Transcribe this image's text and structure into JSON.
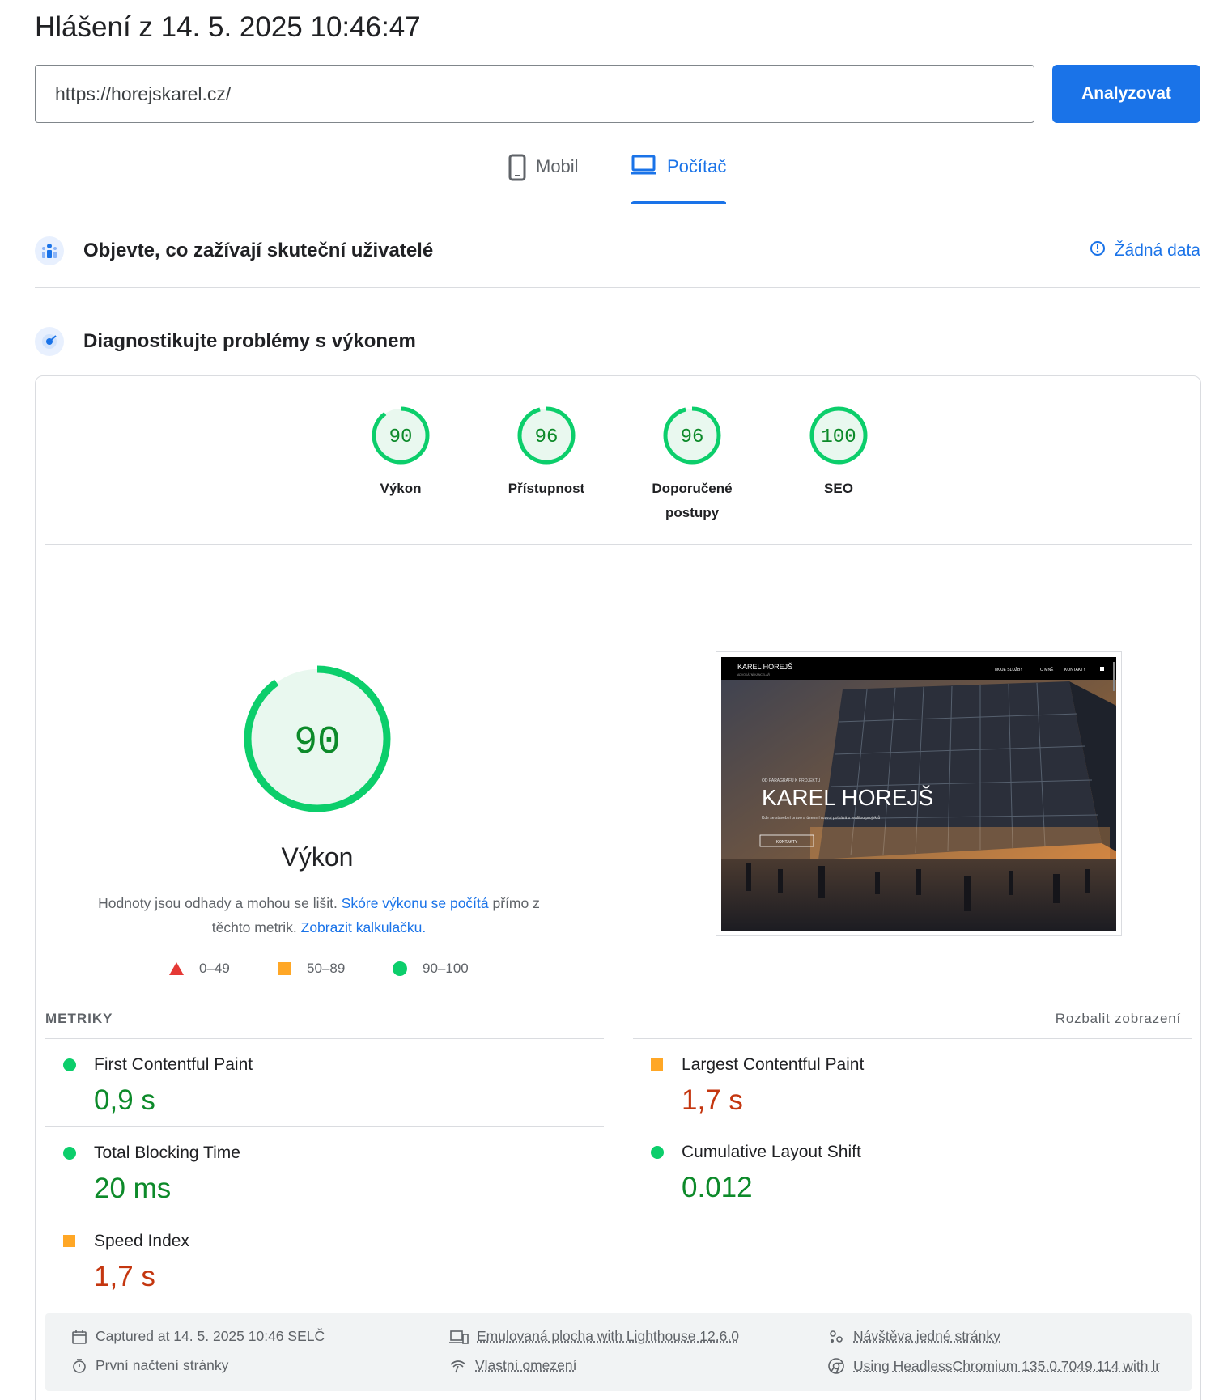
{
  "header": {
    "title": "Hlášení z 14. 5. 2025 10:46:47"
  },
  "search": {
    "url_value": "https://horejskarel.cz/",
    "analyze_label": "Analyzovat"
  },
  "tabs": [
    {
      "label": "Mobil",
      "icon": "phone-icon",
      "active": false
    },
    {
      "label": "Počítač",
      "icon": "laptop-icon",
      "active": true
    }
  ],
  "field_data": {
    "heading": "Objevte, co zažívají skuteční uživatelé",
    "no_data_label": "Žádná data"
  },
  "diagnostics": {
    "heading": "Diagnostikujte problémy s výkonem"
  },
  "category_scores": [
    {
      "label": "Výkon",
      "score": 90
    },
    {
      "label": "Přístupnost",
      "score": 96
    },
    {
      "label": "Doporučené postupy",
      "score": 96
    },
    {
      "label": "SEO",
      "score": 100
    }
  ],
  "performance": {
    "score": 90,
    "label": "Výkon",
    "desc_start": "Hodnoty jsou odhady a mohou se lišit. ",
    "desc_link1": "Skóre výkonu se počítá",
    "desc_mid": " přímo z těchto metrik. ",
    "desc_link2": "Zobrazit kalkulačku."
  },
  "legend": [
    {
      "range": "0–49",
      "shape": "triangle",
      "color": "#e53935"
    },
    {
      "range": "50–89",
      "shape": "square",
      "color": "#ffa726"
    },
    {
      "range": "90–100",
      "shape": "circle",
      "color": "#0cce6b"
    }
  ],
  "screenshot_preview": {
    "site_logo": "KAREL HOREJŠ",
    "site_logo_sub": "ADVOKÁTNÍ KANCELÁŘ",
    "nav": [
      "MOJE SLUŽBY",
      "O MNĚ",
      "KONTAKTY"
    ],
    "kicker": "OD PARAGRAFŮ K PROJEKTU",
    "hero_title": "KAREL HOREJŠ",
    "hero_text": "Kde se stavební právo a územní rozvoj potkává s realitou projektů",
    "hero_button": "KONTAKTY"
  },
  "metrics": {
    "title": "METRIKY",
    "expand_label": "Rozbalit zobrazení",
    "items": [
      {
        "name": "First Contentful Paint",
        "value": "0,9 s",
        "rating": "good"
      },
      {
        "name": "Largest Contentful Paint",
        "value": "1,7 s",
        "rating": "average"
      },
      {
        "name": "Total Blocking Time",
        "value": "20 ms",
        "rating": "good"
      },
      {
        "name": "Cumulative Layout Shift",
        "value": "0.012",
        "rating": "good"
      },
      {
        "name": "Speed Index",
        "value": "1,7 s",
        "rating": "average"
      }
    ]
  },
  "footer": {
    "captured": "Captured at 14. 5. 2025 10:46 SELČ",
    "first_load": "První načtení stránky",
    "emulated": "Emulovaná plocha with Lighthouse 12.6.0",
    "throttling": "Vlastní omezení",
    "single_visit": "Návštěva jedné stránky",
    "browser": "Using HeadlessChromium 135.0.7049.114 with lr"
  },
  "colors": {
    "accent": "#1a73e8",
    "good": "#0cce6b",
    "good_text": "#0d8a2a",
    "average": "#ffa726",
    "average_text": "#c4360f",
    "poor": "#e53935"
  }
}
